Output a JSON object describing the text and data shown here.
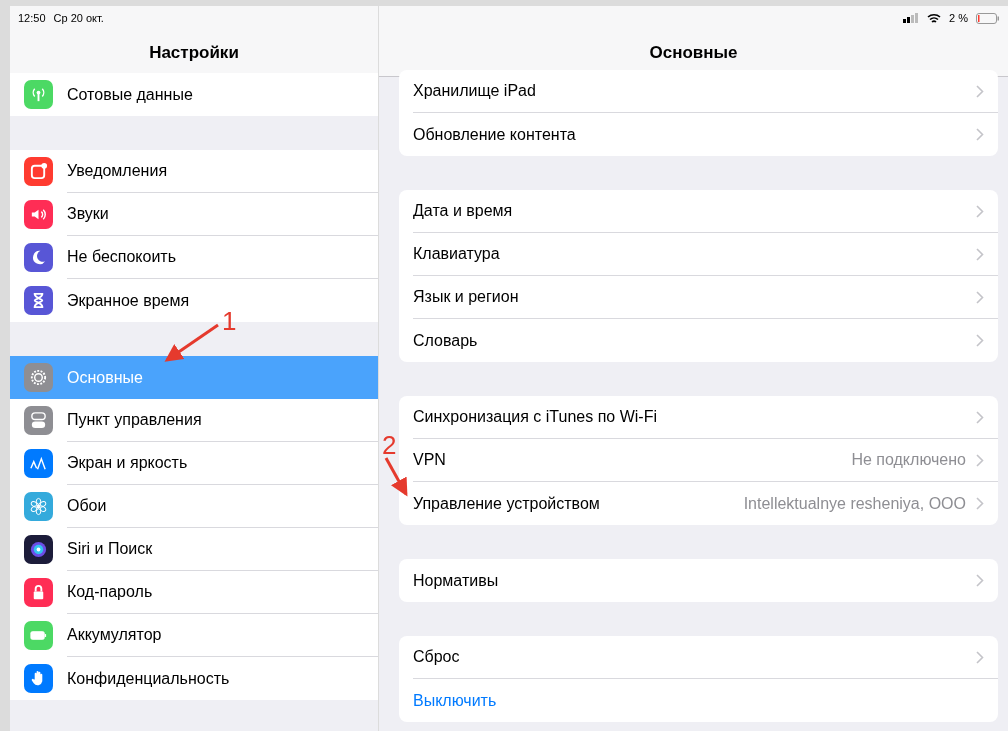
{
  "status_bar": {
    "time": "12:50",
    "date": "Ср 20 окт.",
    "battery": "2 %"
  },
  "sidebar": {
    "title": "Настройки",
    "groups": [
      [
        {
          "label": "Сотовые данные",
          "kind": "antenna",
          "color": "#4cd964",
          "selected": false
        }
      ],
      [
        {
          "label": "Уведомления",
          "kind": "notifications",
          "color": "#ff3b30",
          "selected": false
        },
        {
          "label": "Звуки",
          "kind": "speaker",
          "color": "#ff2d55",
          "selected": false
        },
        {
          "label": "Не беспокоить",
          "kind": "moon",
          "color": "#5856d6",
          "selected": false
        },
        {
          "label": "Экранное время",
          "kind": "hourglass",
          "color": "#5856d6",
          "selected": false
        }
      ],
      [
        {
          "label": "Основные",
          "kind": "gear",
          "color": "#8e8e93",
          "selected": true
        },
        {
          "label": "Пункт управления",
          "kind": "toggles",
          "color": "#8e8e93",
          "selected": false
        },
        {
          "label": "Экран и яркость",
          "kind": "text-size",
          "color": "#007aff",
          "selected": false
        },
        {
          "label": "Обои",
          "kind": "flower",
          "color": "#34aadc",
          "selected": false
        },
        {
          "label": "Siri и Поиск",
          "kind": "siri",
          "color": "#1c1c3a",
          "selected": false
        },
        {
          "label": "Код-пароль",
          "kind": "lock",
          "color": "#ff2d55",
          "selected": false
        },
        {
          "label": "Аккумулятор",
          "kind": "battery",
          "color": "#4cd964",
          "selected": false
        },
        {
          "label": "Конфиденциальность",
          "kind": "hand",
          "color": "#007aff",
          "selected": false
        }
      ]
    ]
  },
  "detail": {
    "title": "Основные",
    "groups": [
      [
        {
          "label": "Хранилище iPad",
          "kind": "nav"
        },
        {
          "label": "Обновление контента",
          "kind": "nav"
        }
      ],
      [
        {
          "label": "Дата и время",
          "kind": "nav"
        },
        {
          "label": "Клавиатура",
          "kind": "nav"
        },
        {
          "label": "Язык и регион",
          "kind": "nav"
        },
        {
          "label": "Словарь",
          "kind": "nav"
        }
      ],
      [
        {
          "label": "Синхронизация с iTunes по Wi-Fi",
          "kind": "nav"
        },
        {
          "label": "VPN",
          "kind": "nav",
          "value": "Не подключено"
        },
        {
          "label": "Управление устройством",
          "kind": "nav",
          "value": "Intellektualnye resheniya, OOO"
        }
      ],
      [
        {
          "label": "Нормативы",
          "kind": "nav"
        }
      ],
      [
        {
          "label": "Сброс",
          "kind": "nav"
        },
        {
          "label": "Выключить",
          "kind": "action"
        }
      ]
    ]
  },
  "annotations": [
    {
      "label": "1"
    },
    {
      "label": "2"
    }
  ]
}
